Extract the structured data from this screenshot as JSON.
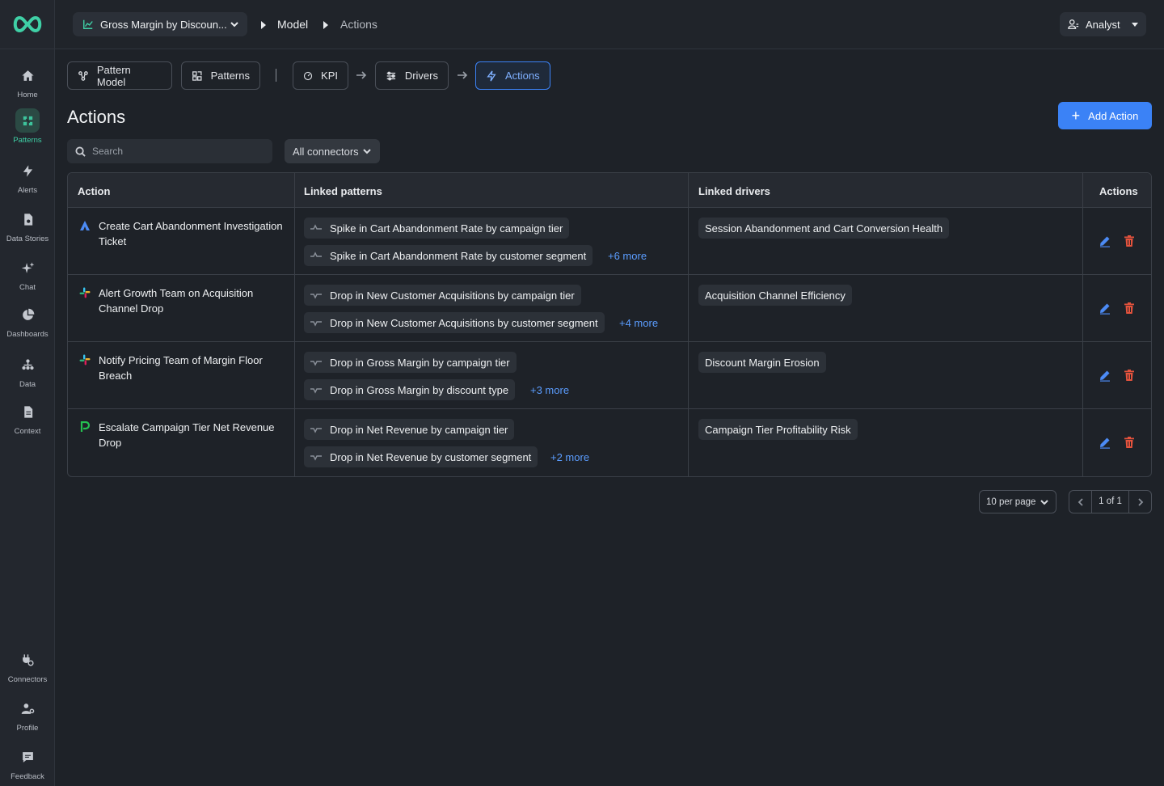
{
  "sidebar": {
    "items": [
      {
        "label": "Home",
        "icon": "home-icon"
      },
      {
        "label": "Patterns",
        "icon": "patterns-icon",
        "active": true
      },
      {
        "label": "Alerts",
        "icon": "lightning-icon"
      },
      {
        "label": "Data Stories",
        "icon": "data-stories-icon"
      },
      {
        "label": "Chat",
        "icon": "sparkle-icon"
      },
      {
        "label": "Dashboards",
        "icon": "pie-chart-icon"
      },
      {
        "label": "Data",
        "icon": "data-tree-icon"
      },
      {
        "label": "Context",
        "icon": "document-icon"
      }
    ],
    "bottom_items": [
      {
        "label": "Connectors",
        "icon": "plug-icon"
      },
      {
        "label": "Profile",
        "icon": "user-gear-icon"
      },
      {
        "label": "Feedback",
        "icon": "chat-bubble-icon"
      }
    ]
  },
  "header": {
    "model_select": "Gross Margin by Discoun...",
    "crumb_model": "Model",
    "crumb_actions": "Actions",
    "user": "Analyst"
  },
  "tabs": [
    {
      "label": "Pattern Model"
    },
    {
      "label": "Patterns"
    },
    {
      "label": "KPI"
    },
    {
      "label": "Drivers"
    },
    {
      "label": "Actions",
      "active": true
    }
  ],
  "page": {
    "title": "Actions",
    "add_button": "Add Action",
    "search_placeholder": "Search",
    "connector_filter": "All connectors"
  },
  "table": {
    "headers": {
      "action": "Action",
      "linked_patterns": "Linked patterns",
      "linked_drivers": "Linked drivers",
      "actions": "Actions"
    },
    "rows": [
      {
        "connector": "jira",
        "name": "Create Cart Abandonment Investigation Ticket",
        "patterns": [
          "Spike in Cart Abandonment Rate by campaign tier",
          "Spike in Cart Abandonment Rate by customer segment"
        ],
        "more": "+6 more",
        "driver": "Session Abandonment and Cart Conversion Health"
      },
      {
        "connector": "slack",
        "name": "Alert Growth Team on Acquisition Channel Drop",
        "patterns": [
          "Drop in New Customer Acquisitions by campaign tier",
          "Drop in New Customer Acquisitions by customer segment"
        ],
        "more": "+4 more",
        "driver": "Acquisition Channel Efficiency"
      },
      {
        "connector": "slack",
        "name": "Notify Pricing Team of Margin Floor Breach",
        "patterns": [
          "Drop in Gross Margin by campaign tier",
          "Drop in Gross Margin by discount type"
        ],
        "more": "+3 more",
        "driver": "Discount Margin Erosion"
      },
      {
        "connector": "pagerduty",
        "name": "Escalate Campaign Tier Net Revenue Drop",
        "patterns": [
          "Drop in Net Revenue by campaign tier",
          "Drop in Net Revenue by customer segment"
        ],
        "more": "+2 more",
        "driver": "Campaign Tier Profitability Risk"
      }
    ]
  },
  "pagination": {
    "per_page": "10 per page",
    "page_info": "1 of 1"
  },
  "colors": {
    "accent": "#3b82f6",
    "brand": "#3fd0a6",
    "delete": "#e5533d"
  }
}
